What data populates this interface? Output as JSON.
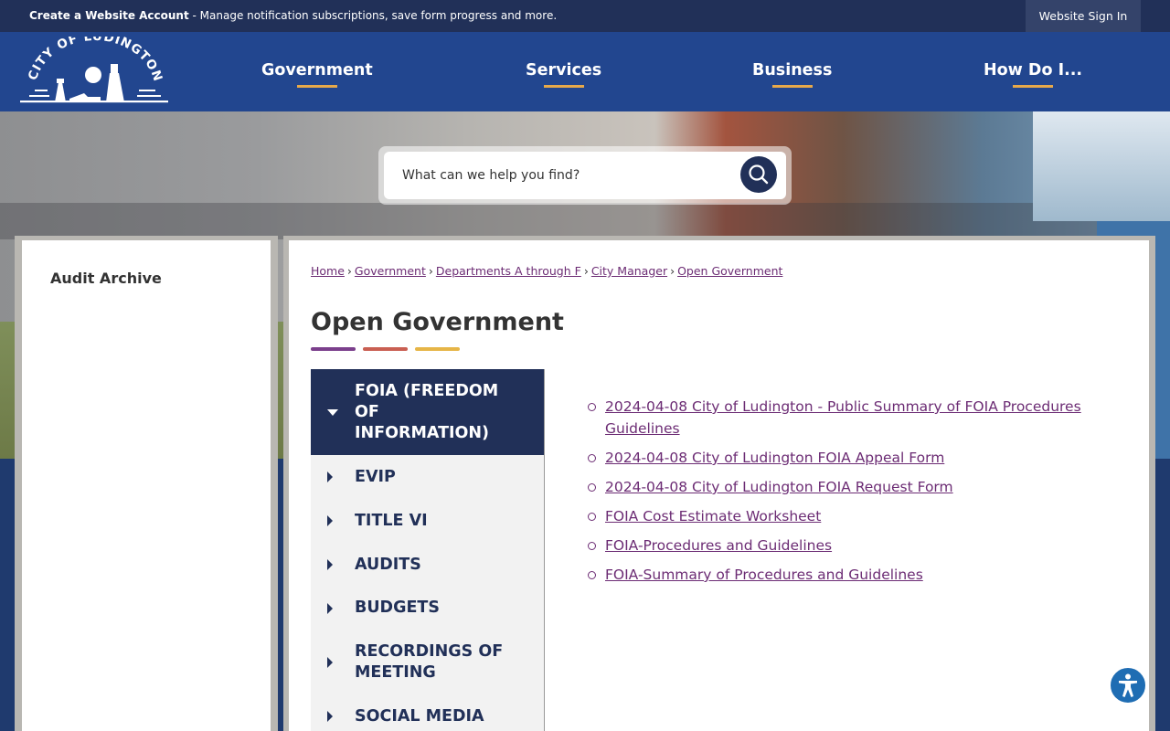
{
  "topbar": {
    "create_account": "Create a Website Account",
    "create_account_desc": " - Manage notification subscriptions, save form progress and more.",
    "sign_in": "Website Sign In"
  },
  "header": {
    "logo_text": "CITY OF LUDINGTON",
    "nav": [
      "Government",
      "Services",
      "Business",
      "How Do I..."
    ]
  },
  "search": {
    "placeholder": "What can we help you find?"
  },
  "sidebar": {
    "items": [
      "Audit Archive"
    ]
  },
  "breadcrumb": [
    "Home",
    "Government",
    "Departments A through F",
    "City Manager",
    "Open Government"
  ],
  "page": {
    "title": "Open Government",
    "title_bar_colors": [
      "#7b3f8c",
      "#c95f52",
      "#e6b547"
    ]
  },
  "accordion": [
    {
      "label": "FOIA (FREEDOM OF INFORMATION)",
      "expanded": true
    },
    {
      "label": "EVIP",
      "expanded": false
    },
    {
      "label": "TITLE VI",
      "expanded": false
    },
    {
      "label": "AUDITS",
      "expanded": false
    },
    {
      "label": "BUDGETS",
      "expanded": false
    },
    {
      "label": "RECORDINGS OF MEETING",
      "expanded": false
    },
    {
      "label": "SOCIAL MEDIA",
      "expanded": false
    }
  ],
  "documents": [
    "2024-04-08 City of Ludington - Public Summary of FOIA Procedures Guidelines",
    "2024-04-08 City of Ludington FOIA Appeal Form",
    "2024-04-08 City of Ludington FOIA Request Form",
    "FOIA Cost Estimate Worksheet",
    "FOIA-Procedures and Guidelines",
    "FOIA-Summary of Procedures and Guidelines"
  ],
  "colors": {
    "header_bg": "#22468f",
    "topbar_bg": "#213058",
    "link": "#6c2c74",
    "accent": "#e7a94a"
  }
}
